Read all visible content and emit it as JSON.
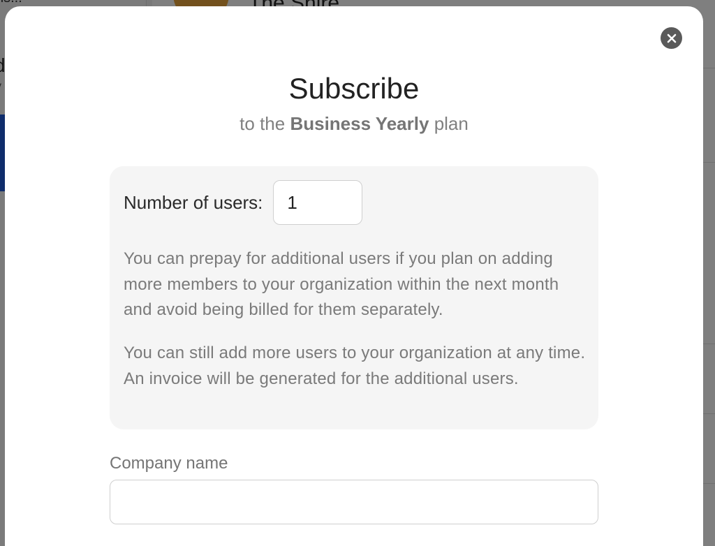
{
  "background": {
    "sidebar_top_text": "ns...",
    "sidebar_fragment": "d",
    "sidebar_fragment_small": "y",
    "org_name": "The Shire",
    "sidebar_active_color": "#1e5bd8",
    "avatar_color": "#e6a33a"
  },
  "modal": {
    "title": "Subscribe",
    "subtitle_prefix": "to the",
    "plan_name": "Business Yearly",
    "subtitle_suffix": "plan",
    "close_icon": "close-x-icon"
  },
  "users": {
    "label": "Number of users:",
    "value": "1"
  },
  "info": {
    "paragraph_1": "You can prepay for additional users if you plan on adding more members to your organization within the next month and avoid being billed for them separately.",
    "paragraph_2": "You can still add more users to your organization at any time. An invoice will be generated for the additional users."
  },
  "company": {
    "label": "Company name",
    "value": ""
  }
}
